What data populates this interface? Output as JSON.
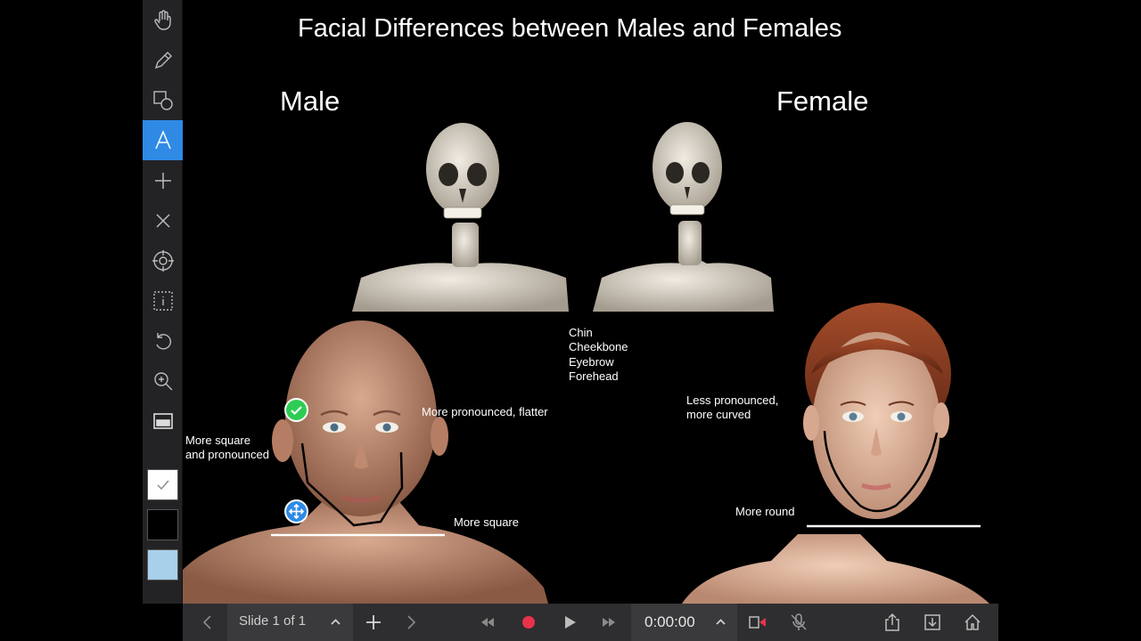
{
  "slide": {
    "title": "Facial Differences between Males and Females",
    "male_label": "Male",
    "female_label": "Female",
    "center_features": [
      "Chin",
      "Cheekbone",
      "Eyebrow",
      "Forehead"
    ],
    "male_notes": {
      "cheekbone": "More pronounced, flatter",
      "jaw": "More square\nand pronounced",
      "chin": "More square"
    },
    "female_notes": {
      "cheekbone": "Less pronounced,\nmore curved",
      "chin": "More round"
    }
  },
  "toolbar": {
    "tools": [
      "hand-icon",
      "pencil-icon",
      "shapes-icon",
      "text-icon",
      "plus-icon",
      "close-icon",
      "target-icon",
      "info-box-icon",
      "undo-icon",
      "zoom-icon",
      "layout-icon"
    ],
    "active_tool": "text-icon",
    "swatches": [
      "#ffffff",
      "#000000",
      "#a8d0ea"
    ]
  },
  "bottom_bar": {
    "slide_label": "Slide 1 of 1",
    "timer": "0:00:00"
  },
  "colors": {
    "accent": "#2f8ae6",
    "record": "#e8334a",
    "check_badge": "#2ecc55"
  }
}
